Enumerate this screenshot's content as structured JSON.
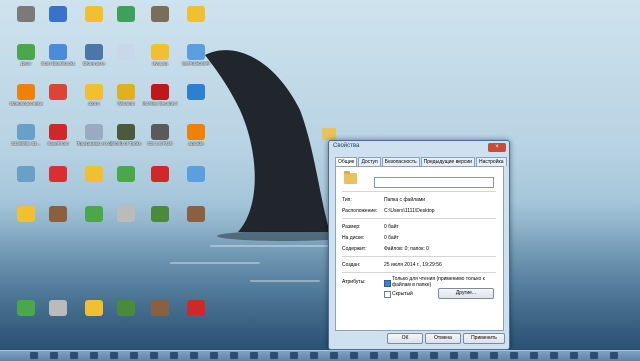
{
  "desktop": {
    "icons": [
      {
        "label": "",
        "color": "#7a7a7a"
      },
      {
        "label": "",
        "color": "#3a72c9"
      },
      {
        "label": "",
        "color": "#f0c030"
      },
      {
        "label": "",
        "color": "#3fa05a"
      },
      {
        "label": "",
        "color": "#7a6d5a"
      },
      {
        "label": "",
        "color": "#f0c030"
      },
      {
        "label": "Дуос",
        "color": "#4aa84a"
      },
      {
        "label": "Start BlueStacks",
        "color": "#4a8cd8"
      },
      {
        "label": "ВКонтакте",
        "color": "#4a76a8"
      },
      {
        "label": "",
        "color": "#c8d8e8"
      },
      {
        "label": "музыка",
        "color": "#f0c030"
      },
      {
        "label": "MyPublicWiFi",
        "color": "#5aa0e0"
      },
      {
        "label": "Одноклассники",
        "color": "#ee8208"
      },
      {
        "label": "",
        "color": "#db4437"
      },
      {
        "label": "фото",
        "color": "#f0c030"
      },
      {
        "label": "Winamp",
        "color": "#e0b020"
      },
      {
        "label": "McAfee Security Sc...",
        "color": "#c01818"
      },
      {
        "label": "",
        "color": "#2d7fd0"
      },
      {
        "label": "2128695_51...",
        "color": "#6aa0c8"
      },
      {
        "label": "SaveFrom",
        "color": "#d02828"
      },
      {
        "label": "Программы и компоненты",
        "color": "#9aaac0"
      },
      {
        "label": "World of Tanks",
        "color": "#4a5a3a"
      },
      {
        "label": "CS 1.6 RUS",
        "color": "#5a5a5a"
      },
      {
        "label": "aptoide",
        "color": "#ee8208"
      },
      {
        "label": "",
        "color": "#6aa0c8"
      },
      {
        "label": "",
        "color": "#d83030"
      },
      {
        "label": "",
        "color": "#f0c030"
      },
      {
        "label": "",
        "color": "#4aa84a"
      },
      {
        "label": "",
        "color": "#d02828"
      },
      {
        "label": "",
        "color": "#5aa0e0"
      },
      {
        "label": "",
        "color": "#f0c030"
      },
      {
        "label": "",
        "color": "#8a6040"
      },
      {
        "label": "",
        "color": "#4aa84a"
      },
      {
        "label": "",
        "color": "#bbbbbb"
      },
      {
        "label": "",
        "color": "#4a8a3a"
      },
      {
        "label": "",
        "color": "#8a6040"
      }
    ]
  },
  "dialog": {
    "title": "Свойства",
    "close": "×",
    "tabs": [
      "Общие",
      "Доступ",
      "Безопасность",
      "Предыдущие версии",
      "Настройка"
    ],
    "type_label": "Тип:",
    "type_value": "Папка с файлами",
    "loc_label": "Расположение:",
    "loc_value": "C:\\Users\\1111\\Desktop",
    "size_label": "Размер:",
    "size_value": "0 байт",
    "disk_label": "На диске:",
    "disk_value": "0 байт",
    "contains_label": "Содержит:",
    "contains_value": "Файлов: 0; папок: 0",
    "created_label": "Создан:",
    "created_value": "25 июля 2014 г., 19:29:56",
    "attr_label": "Атрибуты:",
    "readonly_label": "Только для чтения (применимо только к файлам в папке)",
    "hidden_label": "Скрытый",
    "other_btn": "Другие...",
    "ok_btn": "ОК",
    "cancel_btn": "Отмена",
    "apply_btn": "Применить"
  }
}
